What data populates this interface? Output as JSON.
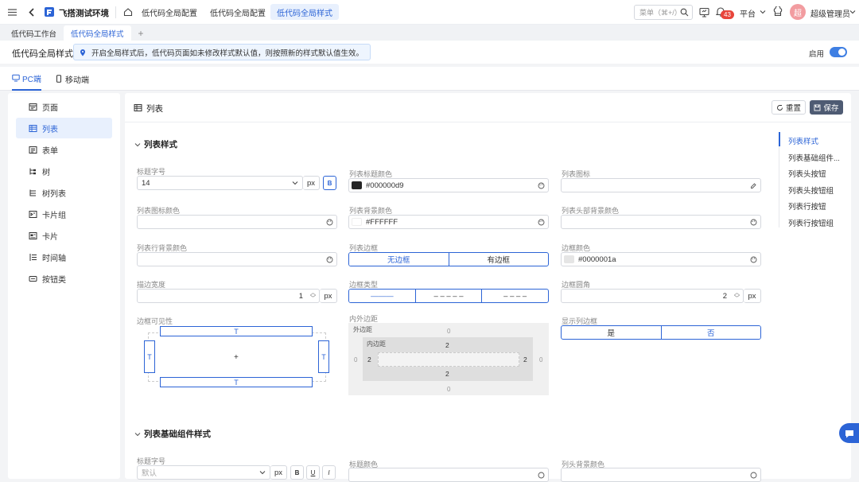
{
  "topbar": {
    "brand": "飞搭测试环境",
    "breadcrumbs": [
      "低代码全局配置",
      "低代码全局配置",
      "低代码全局样式"
    ],
    "search_placeholder": "菜单（⌘+/）",
    "notify_count": "43",
    "platform": "平台",
    "user_avatar_text": "超",
    "user_name": "超级管理员"
  },
  "page_tabs": [
    "低代码工作台",
    "低代码全局样式"
  ],
  "header": {
    "title": "低代码全局样式",
    "notice": "开启全局样式后，低代码页面如未修改样式默认值，则按照新的样式默认值生效。",
    "enable_label": "启用"
  },
  "device_tabs": [
    "PC端",
    "移动端"
  ],
  "sidebar": [
    "页面",
    "列表",
    "表单",
    "树",
    "树列表",
    "卡片组",
    "卡片",
    "时间轴",
    "按钮类"
  ],
  "main": {
    "title": "列表",
    "reset_label": "重置",
    "save_label": "保存",
    "section1_title": "列表样式",
    "section2_title": "列表基础组件样式"
  },
  "anchors": [
    "列表样式",
    "列表基础组件...",
    "列表头按钮",
    "列表头按钮组",
    "列表行按钮",
    "列表行按钮组"
  ],
  "form": {
    "title_font_label": "标题字号",
    "title_font_value": "14",
    "px": "px",
    "bold": "B",
    "title_color_label": "列表标题颜色",
    "title_color_value": "#000000d9",
    "list_icon_label": "列表图标",
    "icon_color_label": "列表图标颜色",
    "bg_color_label": "列表背景颜色",
    "bg_color_value": "#FFFFFF",
    "head_bg_label": "列表头部背景颜色",
    "row_bg_label": "列表行背景颜色",
    "border_label": "列表边框",
    "border_options": [
      "无边框",
      "有边框"
    ],
    "border_color_label": "边框颜色",
    "border_color_value": "#0000001a",
    "stroke_width_label": "描边宽度",
    "stroke_width_value": "1",
    "border_type_label": "边框类型",
    "border_type_options": [
      "———",
      "– – – – –",
      "–  –  –  –"
    ],
    "radius_label": "边框圆角",
    "radius_value": "2",
    "visibility_label": "边框可见性",
    "vis_T": "T",
    "vis_center": "+",
    "padding_label": "内外边距",
    "margin_title": "外边距",
    "padding_title": "内边距",
    "margin_top": "0",
    "margin_bottom": "0",
    "margin_left": "0",
    "margin_right": "0",
    "padding_top": "2",
    "padding_bottom": "2",
    "padding_left": "2",
    "padding_right": "2",
    "show_col_border_label": "显示列边框",
    "show_col_border_options": [
      "是",
      "否"
    ],
    "s2_title_font_label": "标题字号",
    "s2_title_font_placeholder": "默认",
    "s2_u": "U",
    "s2_i": "I",
    "s2_title_color_label": "标题颜色",
    "s2_head_bg_label": "列头背景颜色"
  }
}
